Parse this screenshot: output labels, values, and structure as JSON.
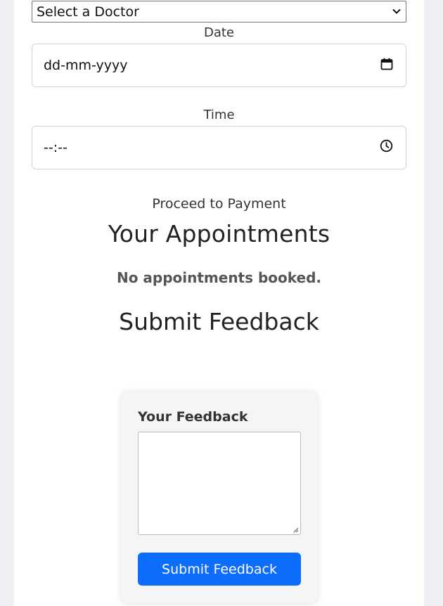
{
  "booking": {
    "doctor_select": {
      "value": "Select a Doctor",
      "icon": "chevron-down-icon"
    },
    "date": {
      "label": "Date",
      "placeholder": "dd-mm-yyyy",
      "icon": "calendar-icon"
    },
    "time": {
      "label": "Time",
      "placeholder": "--:--",
      "icon": "clock-icon"
    },
    "proceed_label": "Proceed to Payment"
  },
  "appointments": {
    "heading": "Your Appointments",
    "empty_message": "No appointments booked."
  },
  "feedback": {
    "heading": "Submit Feedback",
    "label": "Your Feedback",
    "textarea_value": "",
    "submit_label": "Submit Feedback"
  },
  "colors": {
    "page_background": "#eef0f5",
    "panel_background": "#ffffff",
    "primary_button": "#0d6efd",
    "card_background": "#f5f5f5"
  }
}
